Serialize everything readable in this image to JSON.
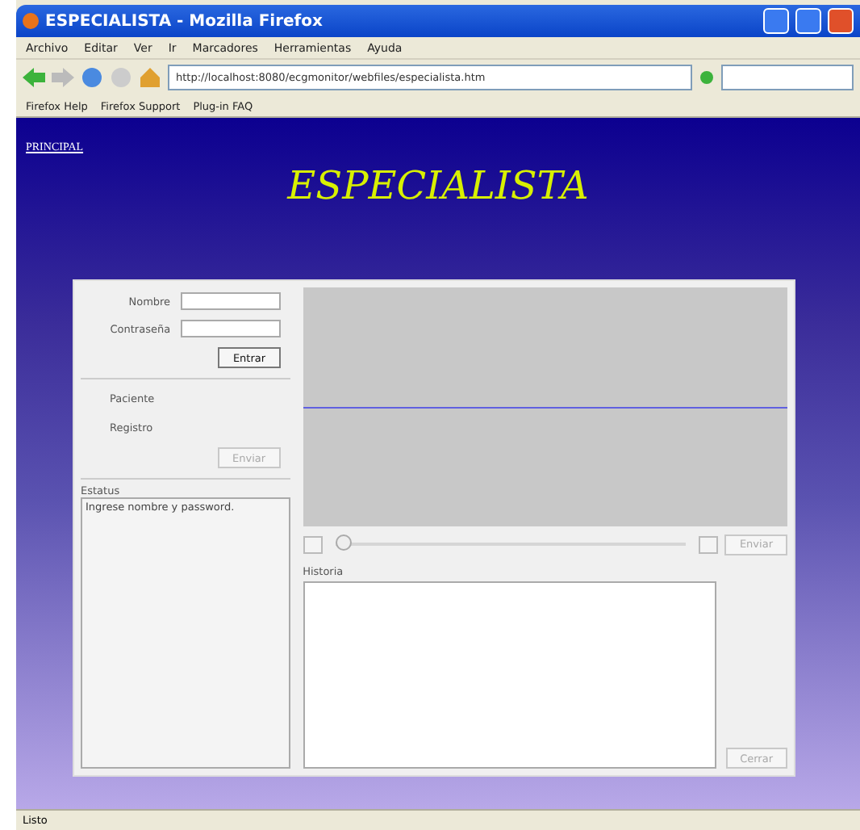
{
  "window": {
    "title": "ESPECIALISTA - Mozilla Firefox"
  },
  "menu": [
    "Archivo",
    "Editar",
    "Ver",
    "Ir",
    "Marcadores",
    "Herramientas",
    "Ayuda"
  ],
  "address": {
    "url": "http://localhost:8080/ecgmonitor/webfiles/especialista.htm"
  },
  "bookmarks": [
    "Firefox Help",
    "Firefox Support",
    "Plug-in FAQ"
  ],
  "page": {
    "link": "PRINCIPAL",
    "heading": "ESPECIALISTA",
    "login": {
      "fields": [
        {
          "label": "Nombre"
        },
        {
          "label": "Contraseña"
        }
      ],
      "button": {
        "label": "Entrar",
        "disabled": false
      }
    },
    "patient": {
      "fields": [
        {
          "label": "Paciente"
        },
        {
          "label": "Registro"
        }
      ],
      "button": {
        "label": "Enviar",
        "disabled": true
      }
    },
    "status": {
      "label": "Estatus",
      "text": "Ingrese nombre y password."
    },
    "player": {
      "level": 0.02,
      "button": {
        "label": "Enviar",
        "disabled": true
      }
    },
    "history": {
      "label": "Historia",
      "button": {
        "label": "Cerrar",
        "disabled": true
      }
    }
  },
  "status_bar": "Listo"
}
